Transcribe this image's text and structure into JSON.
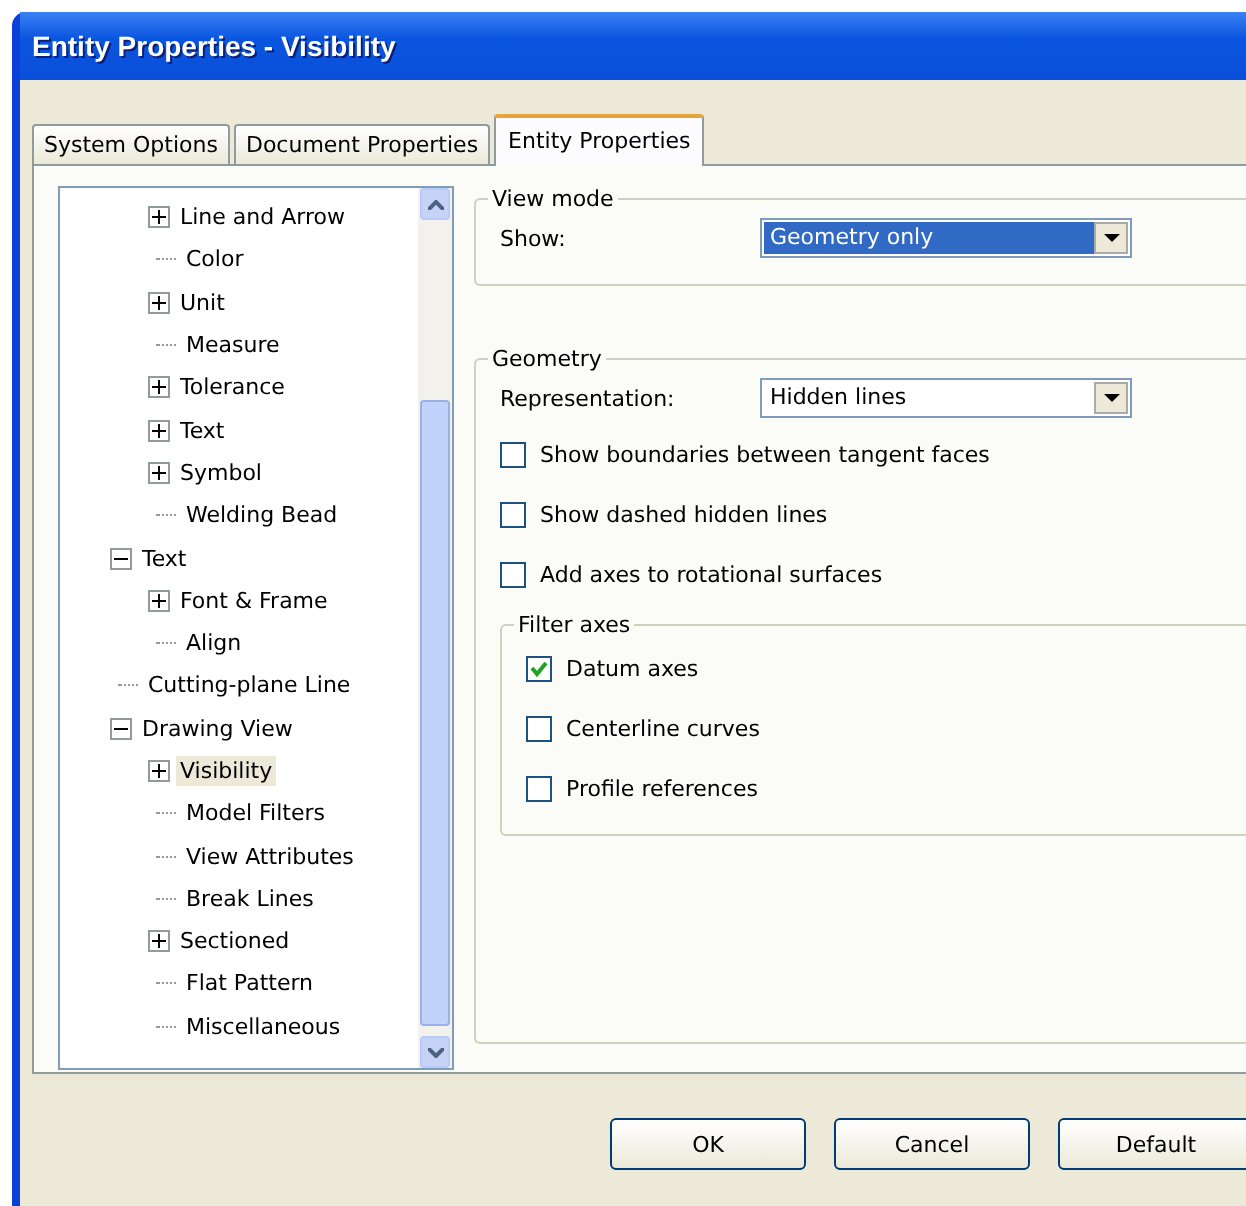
{
  "window": {
    "title": "Entity Properties - Visibility"
  },
  "tabs": [
    {
      "label": "System Options",
      "selected": false
    },
    {
      "label": "Document Properties",
      "selected": false
    },
    {
      "label": "Entity Properties",
      "selected": true
    }
  ],
  "tree": {
    "continued_children": [
      {
        "label": "Line and Arrow",
        "expanded": false,
        "selected": false
      },
      {
        "label": "Color",
        "selected": false
      },
      {
        "label": "Unit",
        "expanded": false,
        "selected": false
      },
      {
        "label": "Measure",
        "selected": false
      },
      {
        "label": "Tolerance",
        "expanded": false,
        "selected": false
      },
      {
        "label": "Text",
        "expanded": false,
        "selected": false
      },
      {
        "label": "Symbol",
        "expanded": false,
        "selected": false
      },
      {
        "label": "Welding Bead",
        "selected": false
      }
    ],
    "items": [
      {
        "label": "Text",
        "expanded": true,
        "selected": false,
        "children": [
          {
            "label": "Font & Frame",
            "expanded": false,
            "selected": false
          },
          {
            "label": "Align",
            "selected": false
          }
        ]
      },
      {
        "label": "Cutting-plane Line",
        "selected": false
      },
      {
        "label": "Drawing View",
        "expanded": true,
        "selected": false,
        "children": [
          {
            "label": "Visibility",
            "expanded": false,
            "selected": true
          },
          {
            "label": "Model Filters",
            "selected": false
          },
          {
            "label": "View Attributes",
            "selected": false
          },
          {
            "label": "Break Lines",
            "selected": false
          },
          {
            "label": "Sectioned",
            "expanded": false,
            "selected": false
          },
          {
            "label": "Flat Pattern",
            "selected": false
          },
          {
            "label": "Miscellaneous",
            "selected": false
          }
        ]
      }
    ]
  },
  "view_mode": {
    "title": "View mode",
    "show_label": "Show:",
    "show_value": "Geometry only"
  },
  "geometry": {
    "title": "Geometry",
    "representation_label": "Representation:",
    "representation_value": "Hidden lines",
    "options": [
      {
        "label": "Show boundaries between tangent faces",
        "checked": false
      },
      {
        "label": "Show dashed hidden lines",
        "checked": false
      },
      {
        "label": "Add axes to rotational surfaces",
        "checked": false
      }
    ],
    "filter_axes": {
      "title": "Filter axes",
      "options": [
        {
          "label": "Datum axes",
          "checked": true
        },
        {
          "label": "Centerline curves",
          "checked": false
        },
        {
          "label": "Profile references",
          "checked": false
        }
      ]
    }
  },
  "buttons": [
    "OK",
    "Cancel",
    "Default"
  ]
}
